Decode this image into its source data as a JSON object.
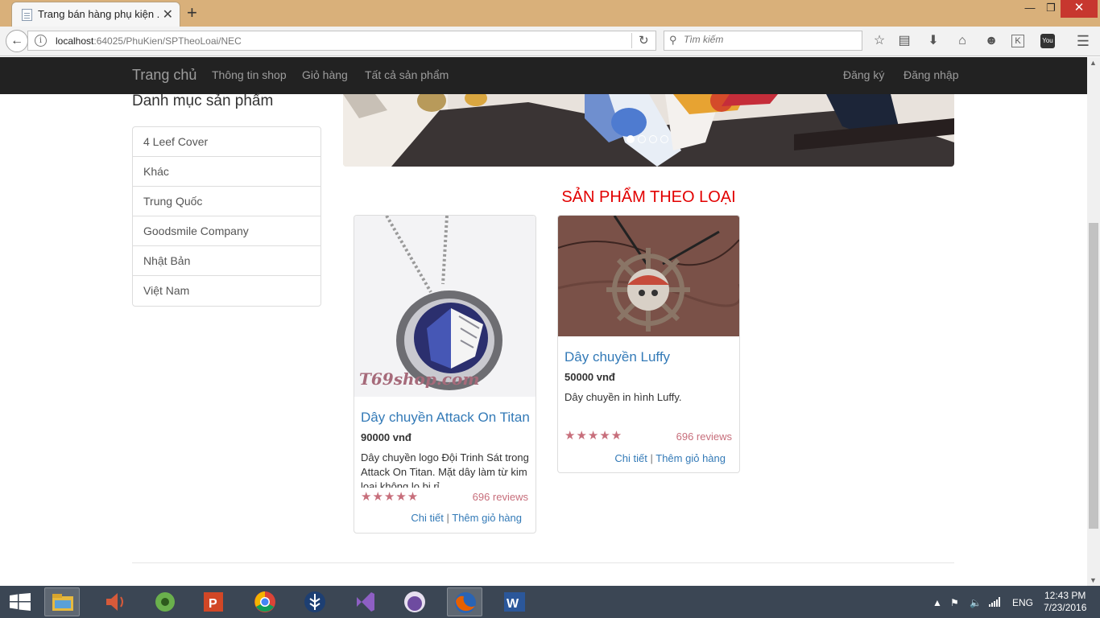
{
  "browser": {
    "tab_title": "Trang bán hàng phụ kiện ...",
    "url_host": "localhost",
    "url_path": ":64025/PhuKien/SPTheoLoai/NEC",
    "search_placeholder": "Tìm kiếm"
  },
  "site_nav": {
    "brand": "Trang chủ",
    "links": [
      "Thông tin shop",
      "Giỏ hàng",
      "Tất cả sản phẩm"
    ],
    "register": "Đăng ký",
    "login": "Đăng nhập"
  },
  "sidebar": {
    "title": "Danh mục sản phẩm",
    "categories": [
      "4 Leef Cover",
      "Khác",
      "Trung Quốc",
      "Goodsmile Company",
      "Nhật Bản",
      "Việt Nam"
    ]
  },
  "carousel": {
    "slides": 4,
    "active_slide": 1
  },
  "section_title": "SẢN PHẨM THEO LOẠI",
  "products": [
    {
      "name": "Dây chuyền Attack On Titan",
      "price": "90000 vnđ",
      "description": "Dây chuyền logo Đội Trinh Sát trong Attack On Titan. Mặt dây làm từ kim loại không lo bị rỉ.",
      "image_watermark": "T69shop.com",
      "rating": 5,
      "stars": "★★★★★",
      "reviews": "696 reviews",
      "detail_label": "Chi tiết",
      "separator": "|",
      "add_cart_label": "Thêm giỏ hàng"
    },
    {
      "name": "Dây chuyền Luffy",
      "price": "50000 vnđ",
      "description": "Dây chuyền in hình Luffy.",
      "rating": 5,
      "stars": "★★★★★",
      "reviews": "696 reviews",
      "detail_label": "Chi tiết",
      "separator": "|",
      "add_cart_label": "Thêm giỏ hàng"
    }
  ],
  "taskbar": {
    "lang": "ENG",
    "time": "12:43 PM",
    "date": "7/23/2016"
  },
  "colors": {
    "tab_strip": "#d9b07a",
    "site_nav_bg": "#222222",
    "section_title": "#e20000",
    "link": "#337ab7",
    "rating": "#c76e7b"
  }
}
